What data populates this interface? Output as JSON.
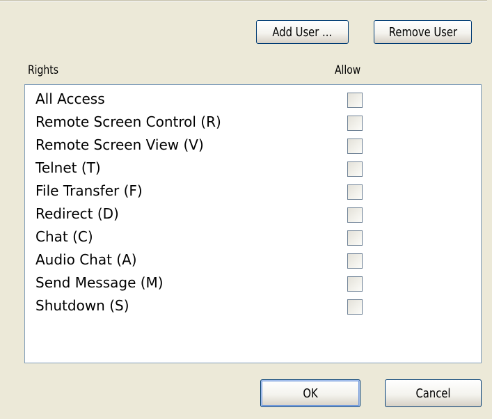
{
  "buttons": {
    "add_user": "Add User ...",
    "remove_user": "Remove User",
    "ok": "OK",
    "cancel": "Cancel"
  },
  "table": {
    "headers": {
      "rights": "Rights",
      "allow": "Allow"
    },
    "rows": [
      {
        "label": "All Access",
        "allowed": false
      },
      {
        "label": "Remote Screen Control (R)",
        "allowed": false
      },
      {
        "label": "Remote Screen View (V)",
        "allowed": false
      },
      {
        "label": "Telnet (T)",
        "allowed": false
      },
      {
        "label": "File Transfer (F)",
        "allowed": false
      },
      {
        "label": "Redirect (D)",
        "allowed": false
      },
      {
        "label": "Chat (C)",
        "allowed": false
      },
      {
        "label": "Audio Chat (A)",
        "allowed": false
      },
      {
        "label": "Send Message (M)",
        "allowed": false
      },
      {
        "label": "Shutdown (S)",
        "allowed": false
      }
    ]
  },
  "colors": {
    "dialog_background": "#ECE9D8",
    "list_border": "#7f9db9",
    "button_border": "#003c74",
    "checkbox_border": "#6f8296"
  }
}
